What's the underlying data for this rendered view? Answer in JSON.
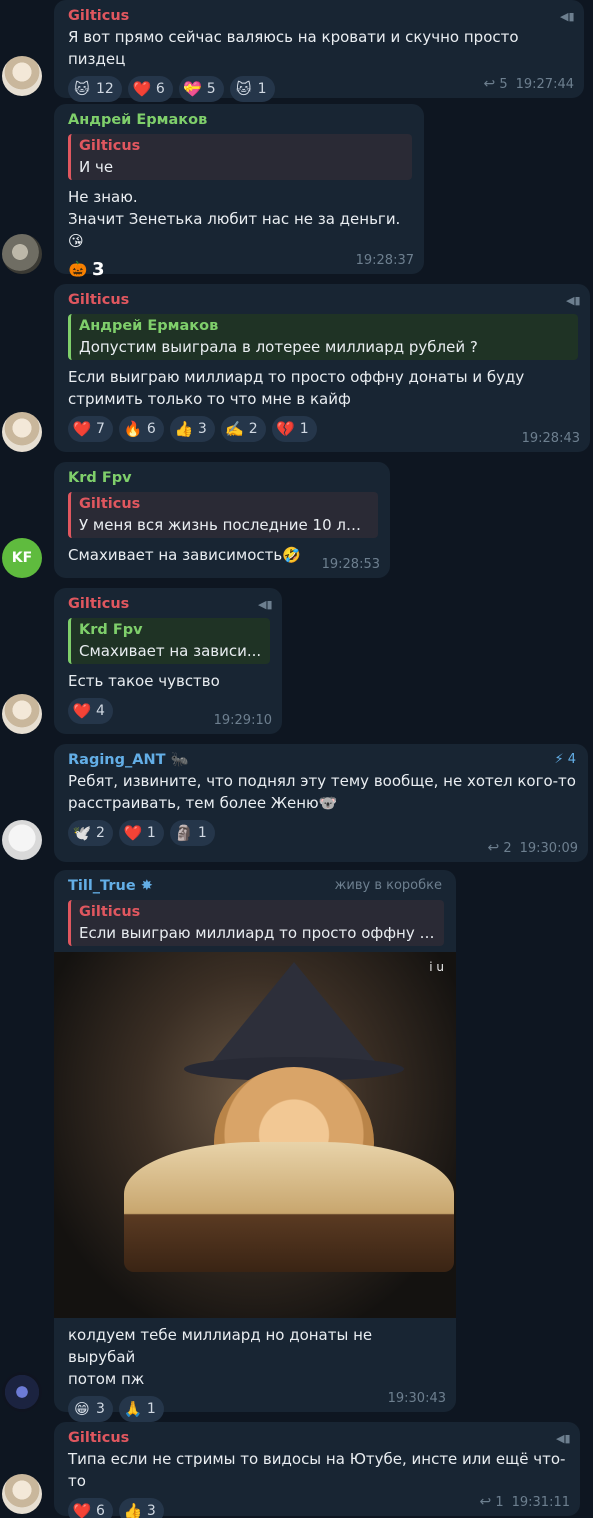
{
  "messages": [
    {
      "sender": "Gilticus",
      "text": "Я вот прямо сейчас валяюсь на кровати и скучно просто пиздец",
      "reactions": [
        {
          "emoji": "🐱",
          "count": "12"
        },
        {
          "emoji": "❤️",
          "count": "6"
        },
        {
          "emoji": "💝",
          "count": "5"
        },
        {
          "emoji": "🐱",
          "count": "1"
        }
      ],
      "replies": "5",
      "time": "19:27:44"
    },
    {
      "sender": "Андрей Ермаков",
      "reply_name": "Gilticus",
      "reply_text": "И че",
      "text": "Не знаю.\nЗначит Зенетька любит нас не за деньги.😘",
      "reactions": [
        {
          "emoji": "🎃",
          "count": "3"
        }
      ],
      "time": "19:28:37"
    },
    {
      "sender": "Gilticus",
      "reply_name": "Андрей Ермаков",
      "reply_text": "Допустим выиграла в лотерее миллиард рублей ?",
      "text": "Если выиграю миллиард то просто оффну донаты и буду\nстримить только то что мне в кайф",
      "reactions": [
        {
          "emoji": "❤️",
          "count": "7"
        },
        {
          "emoji": "🔥",
          "count": "6"
        },
        {
          "emoji": "👍",
          "count": "3"
        },
        {
          "emoji": "✍️",
          "count": "2"
        },
        {
          "emoji": "💔",
          "count": "1"
        }
      ],
      "time": "19:28:43"
    },
    {
      "sender": "Krd Fpv",
      "avatar_initials": "KF",
      "reply_name": "Gilticus",
      "reply_text": "У меня вся жизнь последние 10 лет...",
      "text": "Смахивает на зависимость🤣",
      "time": "19:28:53"
    },
    {
      "sender": "Gilticus",
      "reply_name": "Krd Fpv",
      "reply_text": "Смахивает на зависи...",
      "text": "Есть такое чувство",
      "reactions": [
        {
          "emoji": "❤️",
          "count": "4"
        }
      ],
      "time": "19:29:10"
    },
    {
      "sender": "Raging_ANT",
      "boost_count": "4",
      "text": "Ребят, извините, что поднял эту тему вообще, не хотел кого-то\nрасстраивать, тем более Женю🐨",
      "reactions": [
        {
          "emoji": "🕊️",
          "count": "2"
        },
        {
          "emoji": "❤️",
          "count": "1"
        },
        {
          "emoji": "🗿",
          "count": "1"
        }
      ],
      "replies": "2",
      "time": "19:30:09"
    },
    {
      "sender": "Till_True",
      "status": "живу в коробке",
      "reply_name": "Gilticus",
      "reply_text": "Если выиграю миллиард то просто оффну д...",
      "image_watermark": "i u",
      "text": "колдуем тебе миллиард но донаты не вырубай\nпотом пж",
      "reactions": [
        {
          "emoji": "😁",
          "count": "3"
        },
        {
          "emoji": "🙏",
          "count": "1"
        }
      ],
      "time": "19:30:43"
    },
    {
      "sender": "Gilticus",
      "text": "Типа если не стримы то видосы на Ютубе, инсте или ещё что-то",
      "reactions": [
        {
          "emoji": "❤️",
          "count": "6"
        },
        {
          "emoji": "👍",
          "count": "3"
        }
      ],
      "replies": "1",
      "time": "19:31:11"
    }
  ],
  "icons": {
    "pin": "megaphone-icon",
    "reply_arrow": "reply-arrow-icon",
    "boost": "boost-icon"
  },
  "colors": {
    "background": "#0e1621",
    "bubble": "#182533",
    "red_name": "#e0575f",
    "green_name": "#7fcf6b",
    "blue_name": "#63aee6"
  }
}
